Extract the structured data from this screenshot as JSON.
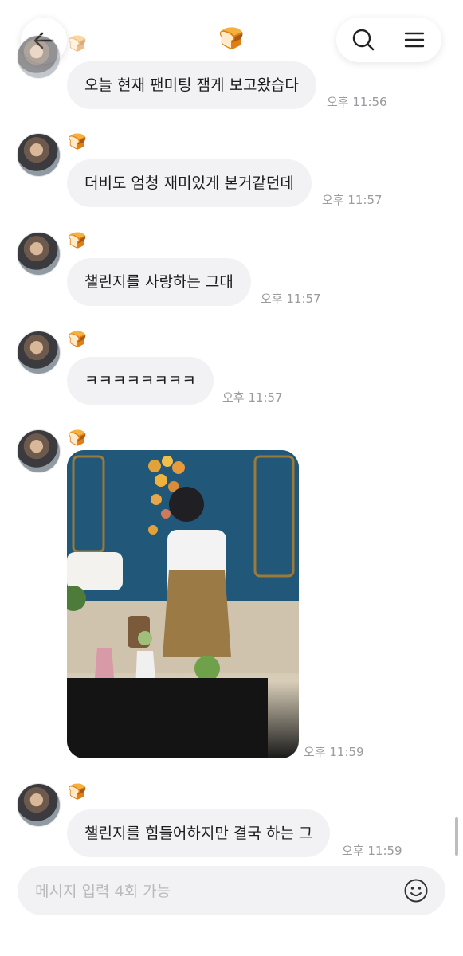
{
  "header": {
    "chat_emoji": "🍞",
    "icons": {
      "back": "arrow-left-icon",
      "search": "search-icon",
      "menu": "hamburger-menu-icon"
    }
  },
  "sender_emoji": "🍞",
  "messages": [
    {
      "type": "text",
      "text": "오늘 현재 팬미팅 잼게 보고왔습다",
      "time": "오후 11:56"
    },
    {
      "type": "text",
      "text": "더비도 엄청 재미있게 본거같던데",
      "time": "오후 11:57"
    },
    {
      "type": "text",
      "text": "챌린지를 사랑하는 그대",
      "time": "오후 11:57"
    },
    {
      "type": "text",
      "text": "ㅋㅋㅋㅋㅋㅋㅋㅋ",
      "time": "오후 11:57"
    },
    {
      "type": "photo",
      "time": "오후 11:59"
    },
    {
      "type": "text",
      "text": "챌린지를 힘들어하지만 결국 하는 그",
      "time": "오후 11:59"
    }
  ],
  "composer": {
    "placeholder": "메시지 입력 4회 가능",
    "emoji_icon": "smiley-face-icon"
  },
  "colors": {
    "bubble_bg": "#f2f2f4",
    "time_text": "#9a9a9f",
    "placeholder_text": "#b9b9be"
  }
}
